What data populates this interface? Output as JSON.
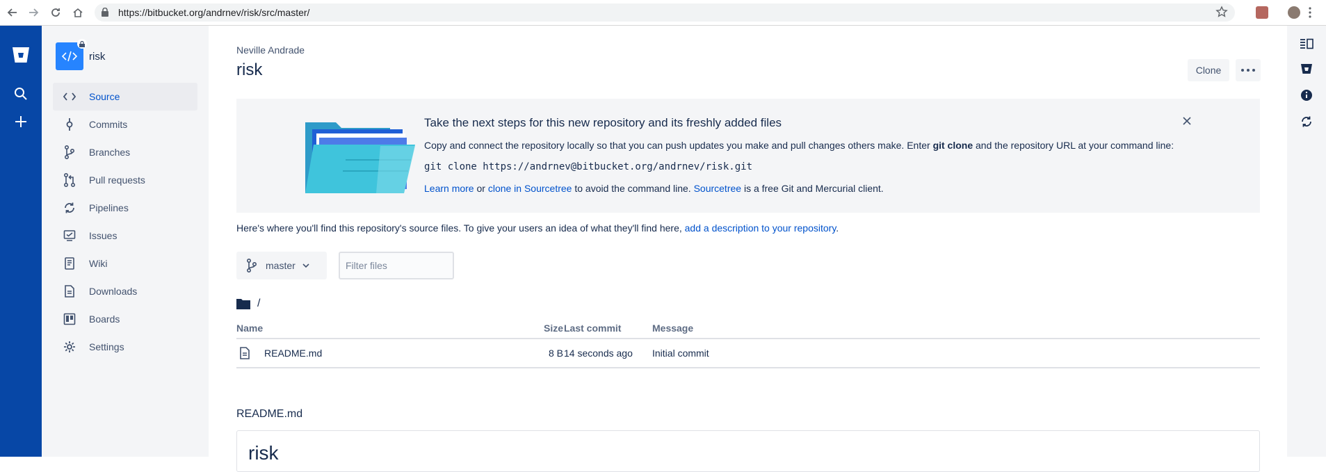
{
  "browser": {
    "url": "https://bitbucket.org/andrnev/risk/src/master/"
  },
  "global_nav": {
    "icons": [
      "bitbucket-logo-icon",
      "search-icon",
      "plus-icon"
    ]
  },
  "repo": {
    "name": "risk",
    "owner": "Neville Andrade"
  },
  "sidebar": {
    "items": [
      {
        "label": "Source",
        "icon": "code-icon",
        "active": true
      },
      {
        "label": "Commits",
        "icon": "commit-icon"
      },
      {
        "label": "Branches",
        "icon": "branch-icon"
      },
      {
        "label": "Pull requests",
        "icon": "pull-request-icon"
      },
      {
        "label": "Pipelines",
        "icon": "pipeline-icon"
      },
      {
        "label": "Issues",
        "icon": "issues-icon"
      },
      {
        "label": "Wiki",
        "icon": "wiki-icon"
      },
      {
        "label": "Downloads",
        "icon": "download-icon"
      },
      {
        "label": "Boards",
        "icon": "boards-icon"
      },
      {
        "label": "Settings",
        "icon": "gear-icon"
      }
    ]
  },
  "header": {
    "clone_label": "Clone"
  },
  "banner": {
    "heading": "Take the next steps for this new repository and its freshly added files",
    "desc_pre": "Copy and connect the repository locally so that you can push updates you make and pull changes others make. Enter ",
    "desc_bold": "git clone",
    "desc_post": " and the repository URL at your command line:",
    "command": "git clone https://andrnev@bitbucket.org/andrnev/risk.git",
    "learn_more": "Learn more",
    "or_text": " or ",
    "clone_sourcetree": "clone in Sourcetree",
    "avoid_text": " to avoid the command line. ",
    "sourcetree": "Sourcetree",
    "free_text": " is a free Git and Mercurial client."
  },
  "intro": {
    "text": "Here's where you'll find this repository's source files. To give your users an idea of what they'll find here, ",
    "link": "add a description to your repository",
    "end": "."
  },
  "branch": {
    "label": "master"
  },
  "filter": {
    "placeholder": "Filter files"
  },
  "path": {
    "root": "/"
  },
  "files": {
    "headers": {
      "name": "Name",
      "size": "Size",
      "last_commit": "Last commit",
      "message": "Message"
    },
    "rows": [
      {
        "name": "README.md",
        "size": "8 B",
        "last_commit": "14 seconds ago",
        "message": "Initial commit"
      }
    ]
  },
  "readme": {
    "filename": "README.md",
    "heading": "risk"
  }
}
